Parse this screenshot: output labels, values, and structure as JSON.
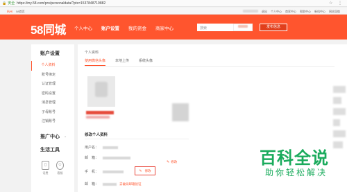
{
  "browser": {
    "secure_label": "安全",
    "url": "https://my.58.com/pro/personaldata/?pts=1537848719882"
  },
  "topbar": {
    "city": "杭州",
    "home": "58首页",
    "links": [
      "退出",
      "个人中心",
      "商家中心",
      "帮助中心",
      "新机中心",
      "网站导航"
    ]
  },
  "header": {
    "logo": "58同城",
    "nav": [
      "个人中心",
      "账户设置",
      "我的资金",
      "商家中心"
    ],
    "search_placeholder": "搜索",
    "post_button": "发布信息"
  },
  "sidebar": {
    "title": "账户设置",
    "items": [
      "个人资料",
      "账号绑定",
      "认证管理",
      "密码设置",
      "消息管理",
      "子母账号",
      "注销账号"
    ],
    "promo_title": "推广中心",
    "tools_title": "生活工具",
    "tools": [
      "话费",
      "客服"
    ]
  },
  "main": {
    "breadcrumb": "个人资料",
    "tabs": [
      "使用微信头像",
      "本地上传",
      "系统头像"
    ],
    "section_title": "修改个人资料",
    "fields": [
      "用户名：",
      "邮　箱：",
      "手　机：",
      "邮　箱："
    ],
    "edit_label": "修改",
    "verify_link": "去破局邮箱验证"
  },
  "watermark": {
    "title": "百科全说",
    "subtitle": "助你轻松解决"
  }
}
